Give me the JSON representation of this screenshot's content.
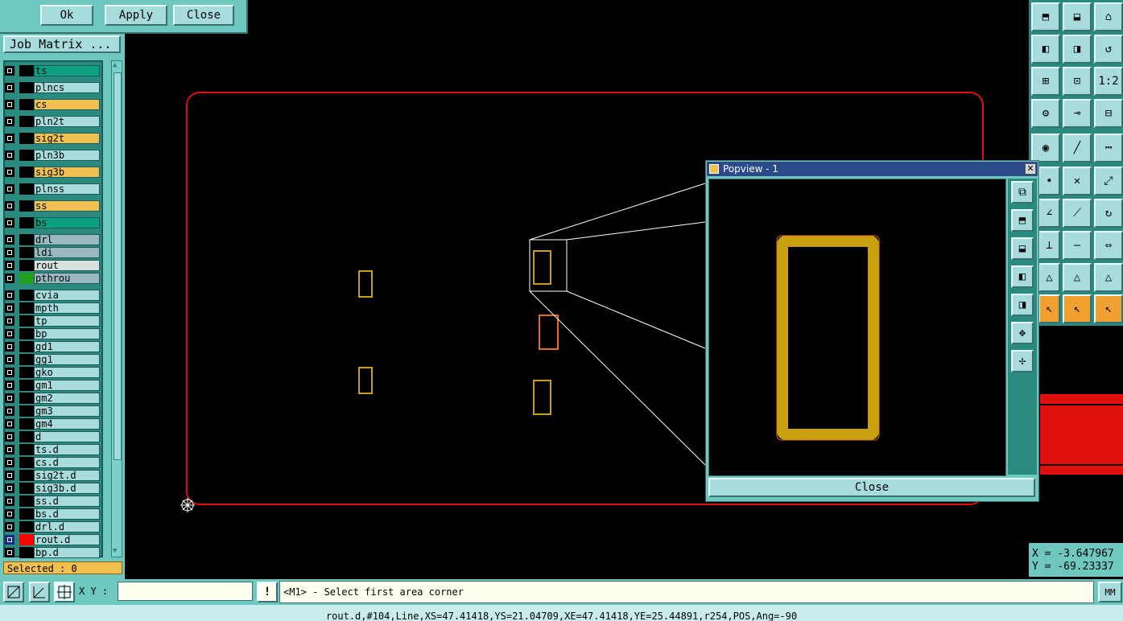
{
  "top_buttons": {
    "ok": "Ok",
    "apply": "Apply",
    "close": "Close"
  },
  "job_matrix_label": "Job Matrix ...",
  "layers": [
    {
      "name": "ts",
      "color": "#0aa080",
      "swatch": "#000"
    },
    {
      "name": "plncs",
      "color": "#a8dcdc",
      "swatch": "#000"
    },
    {
      "name": "cs",
      "color": "#f0c050",
      "swatch": "#000"
    },
    {
      "name": "pln2t",
      "color": "#a8dcdc",
      "swatch": "#000"
    },
    {
      "name": "sig2t",
      "color": "#f0c050",
      "swatch": "#000"
    },
    {
      "name": "pln3b",
      "color": "#a8dcdc",
      "swatch": "#000"
    },
    {
      "name": "sig3b",
      "color": "#f0c050",
      "swatch": "#000"
    },
    {
      "name": "plnss",
      "color": "#a8dcdc",
      "swatch": "#000"
    },
    {
      "name": "ss",
      "color": "#f0c050",
      "swatch": "#000"
    },
    {
      "name": "bs",
      "color": "#0aa080",
      "swatch": "#000"
    },
    {
      "name": "drl",
      "color": "#9ab8c0",
      "swatch": "#000"
    },
    {
      "name": "ldi",
      "color": "#9ab8c0",
      "swatch": "#000"
    },
    {
      "name": "rout",
      "color": "#d8e0e0",
      "swatch": "#000"
    },
    {
      "name": "pthrou",
      "color": "#9ab8c0",
      "swatch": "#20a020"
    },
    {
      "name": "cvia",
      "color": "#a8dcdc",
      "swatch": "#000"
    },
    {
      "name": "mpth",
      "color": "#a8dcdc",
      "swatch": "#000"
    },
    {
      "name": "tp",
      "color": "#a8dcdc",
      "swatch": "#000"
    },
    {
      "name": "bp",
      "color": "#a8dcdc",
      "swatch": "#000"
    },
    {
      "name": "gd1",
      "color": "#a8dcdc",
      "swatch": "#000"
    },
    {
      "name": "gg1",
      "color": "#a8dcdc",
      "swatch": "#000"
    },
    {
      "name": "gko",
      "color": "#a8dcdc",
      "swatch": "#000"
    },
    {
      "name": "gm1",
      "color": "#a8dcdc",
      "swatch": "#000"
    },
    {
      "name": "gm2",
      "color": "#a8dcdc",
      "swatch": "#000"
    },
    {
      "name": "gm3",
      "color": "#a8dcdc",
      "swatch": "#000"
    },
    {
      "name": "gm4",
      "color": "#a8dcdc",
      "swatch": "#000"
    },
    {
      "name": "d",
      "color": "#a8dcdc",
      "swatch": "#000"
    },
    {
      "name": "ts.d",
      "color": "#a8dcdc",
      "swatch": "#000"
    },
    {
      "name": "cs.d",
      "color": "#a8dcdc",
      "swatch": "#000"
    },
    {
      "name": "sig2t.d",
      "color": "#a8dcdc",
      "swatch": "#000"
    },
    {
      "name": "sig3b.d",
      "color": "#a8dcdc",
      "swatch": "#000"
    },
    {
      "name": "ss.d",
      "color": "#a8dcdc",
      "swatch": "#000"
    },
    {
      "name": "bs.d",
      "color": "#a8dcdc",
      "swatch": "#000"
    },
    {
      "name": "drl.d",
      "color": "#a8dcdc",
      "swatch": "#000"
    },
    {
      "name": "rout.d",
      "color": "#a8dcdc",
      "swatch": "#ff0000",
      "active": true
    },
    {
      "name": "bp.d",
      "color": "#a8dcdc",
      "swatch": "#000"
    }
  ],
  "selected_text": "Selected : 0",
  "xy_label": "X Y :",
  "xy_value": "",
  "prompt_message": "<M1> - Select first area corner",
  "units_button": "MM",
  "status_line": "rout.d,#104,Line,XS=47.41418,YS=21.04709,XE=47.41418,YE=25.44891,r254,POS,Ang=-90",
  "coords": {
    "x": "X = -3.647967",
    "y": "Y = -69.23337"
  },
  "popview": {
    "title": "Popview - 1",
    "close_label": "Close"
  },
  "right_toolbar_labels": {
    "one_to_two": "1:2"
  },
  "colors": {
    "board_outline": "#e01010",
    "pad_gold": "#c8a010",
    "pad_orange": "#e07020",
    "panel_teal": "#6ec8c0"
  }
}
